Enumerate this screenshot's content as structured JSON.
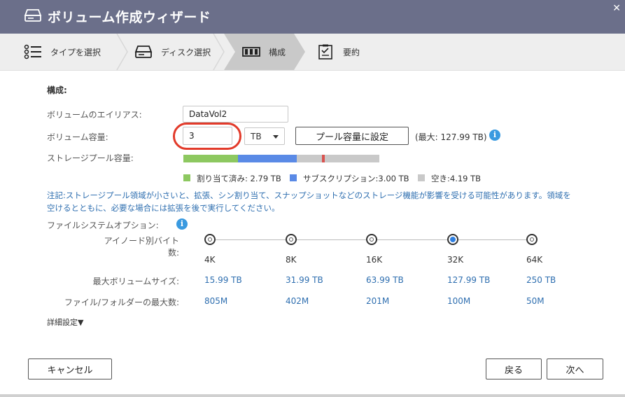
{
  "window": {
    "title": "ボリューム作成ウィザード",
    "close": "✕"
  },
  "steps": [
    {
      "label": "タイプを選択",
      "icon": "list-icon"
    },
    {
      "label": "ディスク選択",
      "icon": "disk-icon"
    },
    {
      "label": "構成",
      "icon": "raid-icon",
      "active": true
    },
    {
      "label": "要約",
      "icon": "clipboard-icon"
    }
  ],
  "config": {
    "section_title": "構成:",
    "alias_label": "ボリュームのエイリアス:",
    "alias_value": "DataVol2",
    "capacity_label": "ボリューム容量:",
    "capacity_value": "3",
    "capacity_unit": "TB",
    "set_pool_button": "プール容量に設定",
    "max_text": "(最大: 127.99 TB)",
    "pool_label": "ストレージプール容量:",
    "pool_bar": {
      "allocated": 2.79,
      "subscription": 3.0,
      "free": 4.19,
      "used_marker": 0.05
    },
    "legend": {
      "allocated": "割り当て済み: 2.79 TB",
      "subscription": "サブスクリプション:3.00 TB",
      "free": "空き:4.19 TB"
    },
    "colors": {
      "allocated": "#8dc860",
      "subscription": "#5a8ae6",
      "free": "#c9c9c9",
      "marker": "#d9534f"
    },
    "note": "注記:ストレージプール領域が小さいと、拡張、シン割り当て、スナップショットなどのストレージ機能が影響を受ける可能性があります。領域を空けるとともに、必要な場合には拡張を後で実行してください。"
  },
  "fs_options": {
    "label": "ファイルシステムオプション:",
    "inode_label": "アイノード別バイト数:",
    "max_vol_label": "最大ボリュームサイズ:",
    "max_files_label": "ファイル/フォルダーの最大数:",
    "columns": [
      {
        "inode": "4K",
        "max_vol": "15.99 TB",
        "max_files": "805M",
        "selected": false
      },
      {
        "inode": "8K",
        "max_vol": "31.99 TB",
        "max_files": "402M",
        "selected": false
      },
      {
        "inode": "16K",
        "max_vol": "63.99 TB",
        "max_files": "201M",
        "selected": false
      },
      {
        "inode": "32K",
        "max_vol": "127.99 TB",
        "max_files": "100M",
        "selected": true
      },
      {
        "inode": "64K",
        "max_vol": "250 TB",
        "max_files": "50M",
        "selected": false
      }
    ],
    "advanced": "詳細設定▼"
  },
  "buttons": {
    "cancel": "キャンセル",
    "back": "戻る",
    "next": "次へ"
  }
}
